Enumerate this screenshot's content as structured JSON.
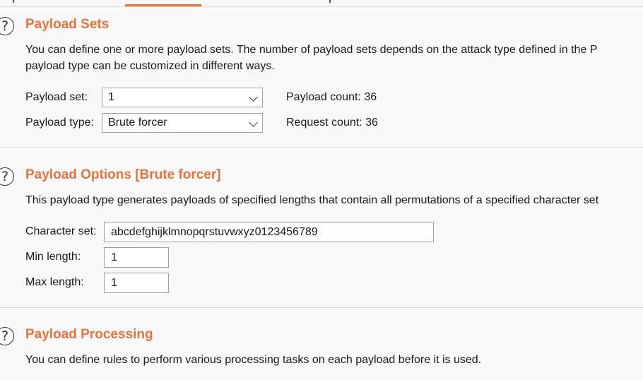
{
  "payload_sets": {
    "title": "Payload Sets",
    "description_line1": "You can define one or more payload sets. The number of payload sets depends on the attack type defined in the P",
    "description_line2": "payload type can be customized in different ways.",
    "payload_set_label": "Payload set:",
    "payload_set_value": "1",
    "payload_type_label": "Payload type:",
    "payload_type_value": "Brute forcer",
    "payload_count_label": "Payload count:",
    "payload_count_value": "36",
    "request_count_label": "Request count:",
    "request_count_value": "36"
  },
  "payload_options": {
    "title": "Payload Options [Brute forcer]",
    "description": "This payload type generates payloads of specified lengths that contain all permutations of a specified character set",
    "character_set_label": "Character set:",
    "character_set_value": "abcdefghijklmnopqrstuvwxyz0123456789",
    "min_length_label": "Min length:",
    "min_length_value": "1",
    "max_length_label": "Max length:",
    "max_length_value": "1"
  },
  "payload_processing": {
    "title": "Payload Processing",
    "description": "You can define rules to perform various processing tasks on each payload before it is used."
  },
  "colors": {
    "accent": "#e8733a",
    "background": "#f8f8f8",
    "divider": "#d9d9d9"
  }
}
